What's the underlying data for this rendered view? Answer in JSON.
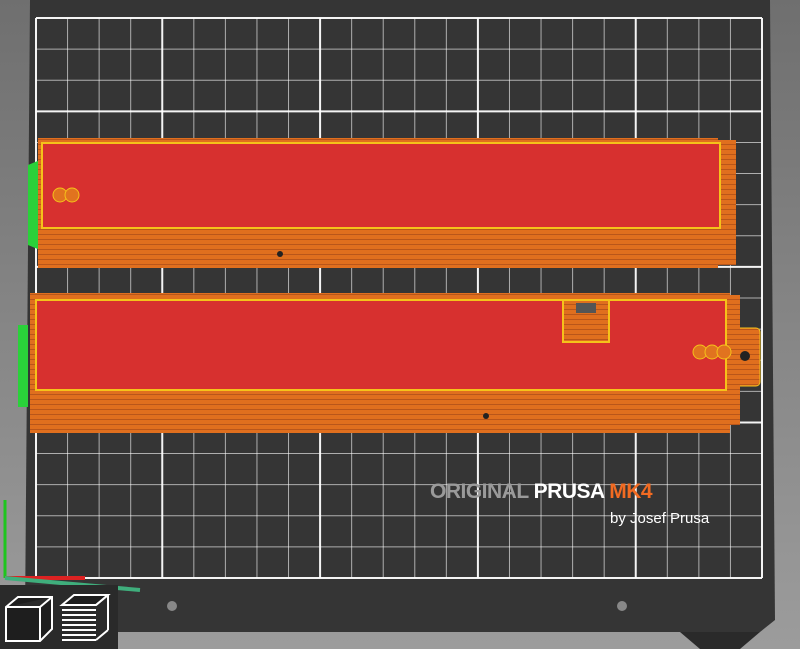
{
  "bed": {
    "brand_original": "ORIGINAL",
    "brand_prusa": "PRUSA",
    "brand_model": "MK4",
    "byline": "by Josef Prusa"
  },
  "colors": {
    "accent": "#f26b22",
    "top_face": "#d7302f",
    "side": "#e1731f",
    "outline": "#f5c21a",
    "support": "#2ad13a"
  },
  "view_toolbar": [
    {
      "name": "3d-view",
      "icon": "cube-icon"
    },
    {
      "name": "preview",
      "icon": "layers-icon"
    }
  ]
}
